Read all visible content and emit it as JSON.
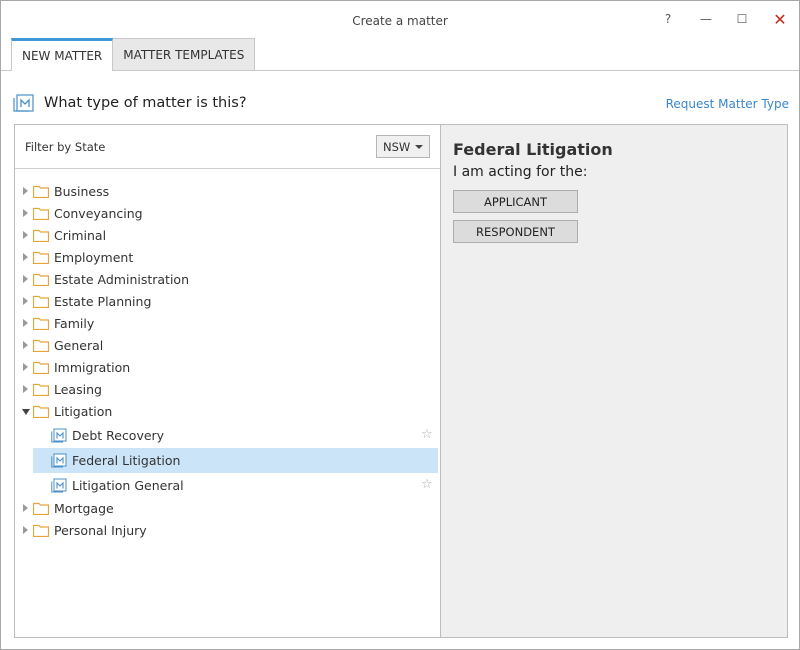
{
  "window": {
    "title": "Create a matter",
    "help_label": "?",
    "minimize_label": "—",
    "maximize_label": "☐",
    "close_label": "✕"
  },
  "tabs": [
    {
      "label": "NEW MATTER",
      "active": true
    },
    {
      "label": "MATTER TEMPLATES",
      "active": false
    }
  ],
  "header": {
    "question": "What type of matter is this?",
    "request_link": "Request Matter Type"
  },
  "filter": {
    "label": "Filter by State",
    "state_value": "NSW"
  },
  "tree": {
    "categories": [
      {
        "label": "Business"
      },
      {
        "label": "Conveyancing"
      },
      {
        "label": "Criminal"
      },
      {
        "label": "Employment"
      },
      {
        "label": "Estate Administration"
      },
      {
        "label": "Estate Planning"
      },
      {
        "label": "Family"
      },
      {
        "label": "General"
      },
      {
        "label": "Immigration"
      },
      {
        "label": "Leasing"
      },
      {
        "label": "Litigation",
        "expanded": true
      },
      {
        "label": "Mortgage"
      },
      {
        "label": "Personal Injury"
      }
    ],
    "litigation_children": [
      {
        "label": "Debt Recovery",
        "starred": false
      },
      {
        "label": "Federal Litigation",
        "selected": true
      },
      {
        "label": "Litigation General",
        "starred": false
      }
    ]
  },
  "detail": {
    "title": "Federal Litigation",
    "subtitle": "I am acting for the:",
    "buttons": [
      "APPLICANT",
      "RESPONDENT"
    ]
  },
  "colors": {
    "accent": "#3f97d6",
    "link": "#3a87c9",
    "selection": "#cce4f7",
    "folder": "#e8a33a",
    "close": "#c42b1c"
  },
  "icons": {
    "star": "☆"
  }
}
